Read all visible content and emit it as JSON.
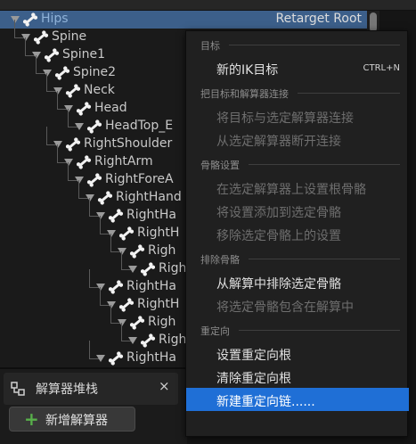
{
  "hierarchy": {
    "root_chain_label": "Retarget Root",
    "bones": [
      {
        "name": "Hips",
        "depth": 0,
        "selected": true
      },
      {
        "name": "Spine",
        "depth": 1
      },
      {
        "name": "Spine1",
        "depth": 2
      },
      {
        "name": "Spine2",
        "depth": 3
      },
      {
        "name": "Neck",
        "depth": 4
      },
      {
        "name": "Head",
        "depth": 5
      },
      {
        "name": "HeadTop_E",
        "depth": 6
      },
      {
        "name": "RightShoulder",
        "depth": 4
      },
      {
        "name": "RightArm",
        "depth": 5
      },
      {
        "name": "RightForeA",
        "depth": 6
      },
      {
        "name": "RightHand",
        "depth": 7
      },
      {
        "name": "RightHa",
        "depth": 8
      },
      {
        "name": "RightH",
        "depth": 9
      },
      {
        "name": "Righ",
        "depth": 10
      },
      {
        "name": "Righ",
        "depth": 11
      },
      {
        "name": "RightHa",
        "depth": 8
      },
      {
        "name": "RightH",
        "depth": 9
      },
      {
        "name": "Righ",
        "depth": 10
      },
      {
        "name": "Righ",
        "depth": 11
      },
      {
        "name": "RightHa",
        "depth": 8
      }
    ]
  },
  "solver_stack": {
    "tab_label": "解算器堆栈",
    "close_label": "×",
    "add_button_plus": "+",
    "add_button_label": "新增解算器"
  },
  "context_menu": {
    "sections": [
      {
        "title": "目标",
        "items": [
          {
            "label": "新的IK目标",
            "shortcut": "CTRL+N",
            "enabled": true
          }
        ]
      },
      {
        "title": "把目标和解算器连接",
        "items": [
          {
            "label": "将目标与选定解算器连接",
            "enabled": false
          },
          {
            "label": "从选定解算器断开连接",
            "enabled": false
          }
        ]
      },
      {
        "title": "骨骼设置",
        "items": [
          {
            "label": "在选定解算器上设置根骨骼",
            "enabled": false
          },
          {
            "label": "将设置添加到选定骨骼",
            "enabled": false
          },
          {
            "label": "移除选定骨骼上的设置",
            "enabled": false
          }
        ]
      },
      {
        "title": "排除骨骼",
        "items": [
          {
            "label": "从解算中排除选定骨骼",
            "enabled": true
          },
          {
            "label": "将选定骨骼包含在解算中",
            "enabled": false
          }
        ]
      },
      {
        "title": "重定向",
        "items": [
          {
            "label": "设置重定向根",
            "enabled": true
          },
          {
            "label": "清除重定向根",
            "enabled": true
          },
          {
            "label": "新建重定向链......",
            "enabled": true,
            "highlighted": true
          }
        ]
      }
    ]
  },
  "colors": {
    "selection": "#3c5f8a",
    "menu_highlight": "#1f6fd6",
    "add_plus": "#58b04a"
  }
}
